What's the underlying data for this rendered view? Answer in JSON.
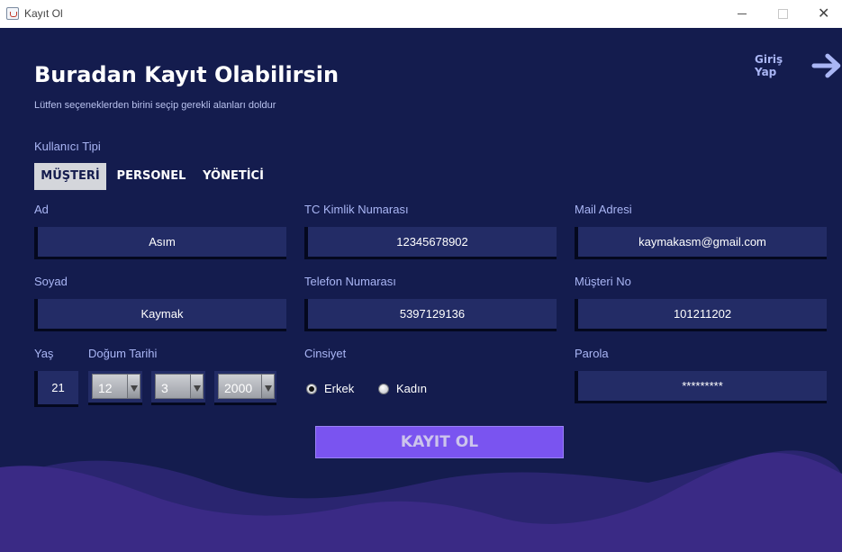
{
  "window": {
    "title": "Kayıt Ol"
  },
  "header": {
    "title": "Buradan Kayıt Olabilirsin",
    "subtitle": "Lütfen seçeneklerden birini seçip gerekli alanları doldur",
    "login_link": "Giriş Yap"
  },
  "user_type": {
    "label": "Kullanıcı Tipi",
    "tabs": [
      "MÜŞTERİ",
      "PERSONEL",
      "YÖNETİCİ"
    ],
    "selected": "MÜŞTERİ"
  },
  "form": {
    "ad": {
      "label": "Ad",
      "value": "Asım"
    },
    "soyad": {
      "label": "Soyad",
      "value": "Kaymak"
    },
    "tc": {
      "label": "TC Kimlik Numarası",
      "value": "12345678902"
    },
    "telefon": {
      "label": "Telefon Numarası",
      "value": "5397129136"
    },
    "mail": {
      "label": "Mail Adresi",
      "value": "kaymakasm@gmail.com"
    },
    "musteri_no": {
      "label": "Müşteri No",
      "value": "101211202"
    },
    "yas": {
      "label": "Yaş",
      "value": "21"
    },
    "dogum_tarihi": {
      "label": "Doğum Tarihi",
      "month": "12",
      "day": "3",
      "year": "2000"
    },
    "cinsiyet": {
      "label": "Cinsiyet",
      "options": [
        "Erkek",
        "Kadın"
      ],
      "selected": "Erkek"
    },
    "parola": {
      "label": "Parola",
      "value": "*********"
    }
  },
  "submit_label": "KAYIT OL",
  "colors": {
    "background": "#141c4e",
    "field": "#232c66",
    "accent": "#7a54f0",
    "label": "#aab6f5",
    "wave_front": "#3a2a85",
    "wave_back": "#2a2570"
  }
}
